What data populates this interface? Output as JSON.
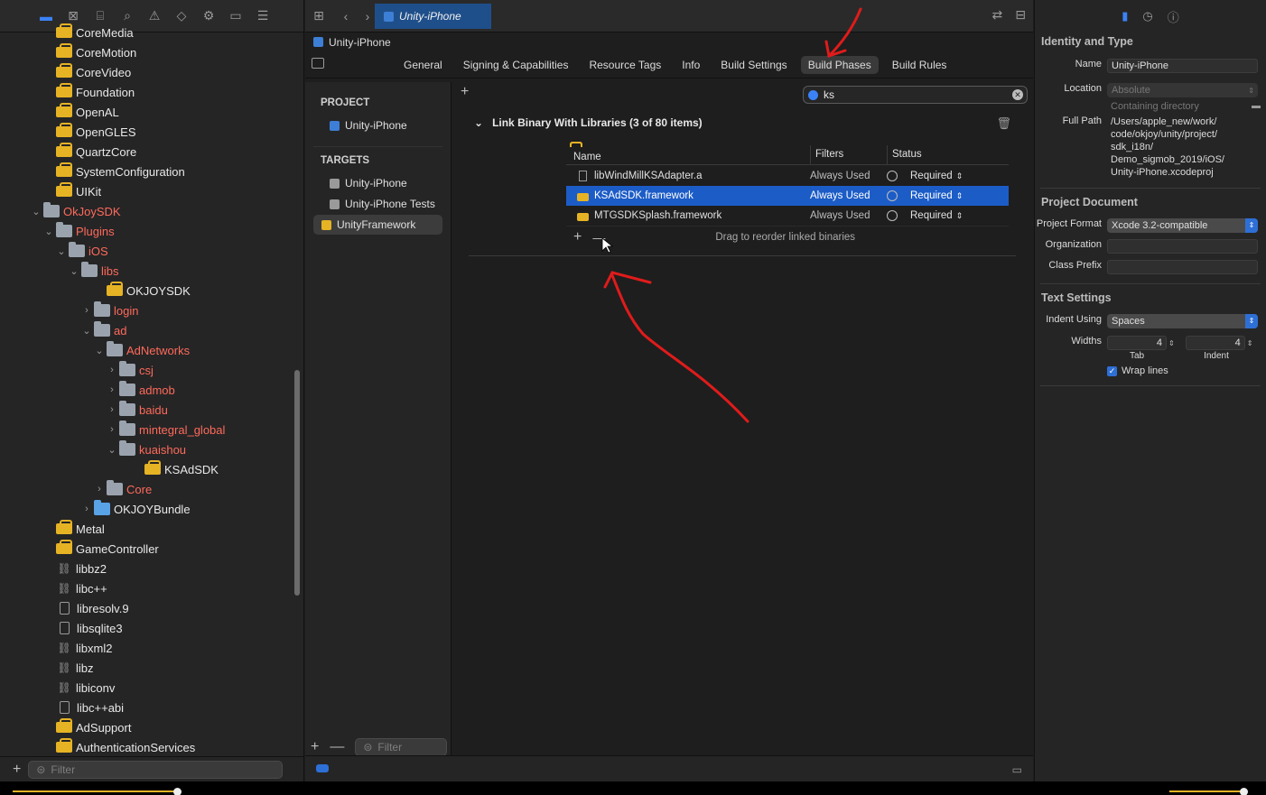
{
  "navigator": {
    "filter_placeholder": "Filter",
    "tree": [
      {
        "label": "CoreMedia",
        "icon": "framework",
        "indent": 60,
        "chevron": "",
        "red": false
      },
      {
        "label": "CoreMotion",
        "icon": "framework",
        "indent": 60,
        "chevron": "",
        "red": false
      },
      {
        "label": "CoreVideo",
        "icon": "framework",
        "indent": 60,
        "chevron": "",
        "red": false
      },
      {
        "label": "Foundation",
        "icon": "framework",
        "indent": 60,
        "chevron": "",
        "red": false
      },
      {
        "label": "OpenAL",
        "icon": "framework",
        "indent": 60,
        "chevron": "",
        "red": false
      },
      {
        "label": "OpenGLES",
        "icon": "framework",
        "indent": 60,
        "chevron": "",
        "red": false
      },
      {
        "label": "QuartzCore",
        "icon": "framework",
        "indent": 60,
        "chevron": "",
        "red": false
      },
      {
        "label": "SystemConfiguration",
        "icon": "framework",
        "indent": 60,
        "chevron": "",
        "red": false
      },
      {
        "label": "UIKit",
        "icon": "framework",
        "indent": 60,
        "chevron": "",
        "red": false
      },
      {
        "label": "OkJoySDK",
        "icon": "folder",
        "indent": 46,
        "chevron": "v",
        "red": true
      },
      {
        "label": "Plugins",
        "icon": "folder",
        "indent": 60,
        "chevron": "v",
        "red": true
      },
      {
        "label": "iOS",
        "icon": "folder",
        "indent": 74,
        "chevron": "v",
        "red": true
      },
      {
        "label": "libs",
        "icon": "folder",
        "indent": 88,
        "chevron": "v",
        "red": true
      },
      {
        "label": "OKJOYSDK",
        "icon": "framework",
        "indent": 116,
        "chevron": "",
        "red": false
      },
      {
        "label": "login",
        "icon": "folder",
        "indent": 102,
        "chevron": ">",
        "red": true
      },
      {
        "label": "ad",
        "icon": "folder",
        "indent": 102,
        "chevron": "v",
        "red": true
      },
      {
        "label": "AdNetworks",
        "icon": "folder",
        "indent": 116,
        "chevron": "v",
        "red": true
      },
      {
        "label": "csj",
        "icon": "folder",
        "indent": 130,
        "chevron": ">",
        "red": true
      },
      {
        "label": "admob",
        "icon": "folder",
        "indent": 130,
        "chevron": ">",
        "red": true
      },
      {
        "label": "baidu",
        "icon": "folder",
        "indent": 130,
        "chevron": ">",
        "red": true
      },
      {
        "label": "mintegral_global",
        "icon": "folder",
        "indent": 130,
        "chevron": ">",
        "red": true
      },
      {
        "label": "kuaishou",
        "icon": "folder",
        "indent": 130,
        "chevron": "v",
        "red": true
      },
      {
        "label": "KSAdSDK",
        "icon": "framework",
        "indent": 158,
        "chevron": "",
        "red": false
      },
      {
        "label": "Core",
        "icon": "folder",
        "indent": 116,
        "chevron": ">",
        "red": true
      },
      {
        "label": "OKJOYBundle",
        "icon": "bluefolder",
        "indent": 102,
        "chevron": ">",
        "red": false
      },
      {
        "label": "Metal",
        "icon": "framework",
        "indent": 60,
        "chevron": "",
        "red": false
      },
      {
        "label": "GameController",
        "icon": "framework",
        "indent": 60,
        "chevron": "",
        "red": false
      },
      {
        "label": "libbz2",
        "icon": "link",
        "indent": 60,
        "chevron": "",
        "red": false
      },
      {
        "label": "libc++",
        "icon": "link",
        "indent": 60,
        "chevron": "",
        "red": false
      },
      {
        "label": "libresolv.9",
        "icon": "doc",
        "indent": 60,
        "chevron": "",
        "red": false
      },
      {
        "label": "libsqlite3",
        "icon": "doc",
        "indent": 60,
        "chevron": "",
        "red": false
      },
      {
        "label": "libxml2",
        "icon": "link",
        "indent": 60,
        "chevron": "",
        "red": false
      },
      {
        "label": "libz",
        "icon": "link",
        "indent": 60,
        "chevron": "",
        "red": false
      },
      {
        "label": "libiconv",
        "icon": "link",
        "indent": 60,
        "chevron": "",
        "red": false
      },
      {
        "label": "libc++abi",
        "icon": "doc",
        "indent": 60,
        "chevron": "",
        "red": false
      },
      {
        "label": "AdSupport",
        "icon": "framework",
        "indent": 60,
        "chevron": "",
        "red": false
      },
      {
        "label": "AuthenticationServices",
        "icon": "framework",
        "indent": 60,
        "chevron": "",
        "red": false
      }
    ]
  },
  "editor": {
    "tab_title": "Unity-iPhone",
    "jumpbar": "Unity-iPhone",
    "tabs": [
      "General",
      "Signing & Capabilities",
      "Resource Tags",
      "Info",
      "Build Settings",
      "Build Phases",
      "Build Rules"
    ],
    "active_tab": "Build Phases",
    "project_header": "PROJECT",
    "project_item": "Unity-iPhone",
    "targets_header": "TARGETS",
    "targets": [
      "Unity-iPhone",
      "Unity-iPhone Tests",
      "UnityFramework"
    ],
    "selected_target": "UnityFramework",
    "targets_filter_placeholder": "Filter",
    "search_value": "ks",
    "phase_title": "Link Binary With Libraries (3 of 80 items)",
    "columns": {
      "name": "Name",
      "filters": "Filters",
      "status": "Status"
    },
    "libraries": [
      {
        "name": "libWindMillKSAdapter.a",
        "icon": "doc",
        "filters": "Always Used",
        "status": "Required",
        "selected": false
      },
      {
        "name": "KSAdSDK.framework",
        "icon": "framework",
        "filters": "Always Used",
        "status": "Required",
        "selected": true
      },
      {
        "name": "MTGSDKSplash.framework",
        "icon": "framework",
        "filters": "Always Used",
        "status": "Required",
        "selected": false
      }
    ],
    "drag_hint": "Drag to reorder linked binaries"
  },
  "inspector": {
    "identity_title": "Identity and Type",
    "name_label": "Name",
    "name_value": "Unity-iPhone",
    "location_label": "Location",
    "location_value": "Absolute",
    "containing_dir": "Containing directory",
    "fullpath_label": "Full Path",
    "fullpath_lines": [
      "/Users/apple_new/work/",
      "code/okjoy/unity/project/",
      "sdk_i18n/",
      "Demo_sigmob_2019/iOS/",
      "Unity-iPhone.xcodeproj"
    ],
    "project_doc_title": "Project Document",
    "format_label": "Project Format",
    "format_value": "Xcode 3.2-compatible",
    "org_label": "Organization",
    "prefix_label": "Class Prefix",
    "text_settings_title": "Text Settings",
    "indent_using_label": "Indent Using",
    "indent_using_value": "Spaces",
    "widths_label": "Widths",
    "tab_width": "4",
    "indent_width": "4",
    "tab_caption": "Tab",
    "indent_caption": "Indent",
    "wrap_label": "Wrap lines"
  },
  "colors": {
    "accent": "#1c5cc7",
    "annotation": "#e01b1b",
    "missing_file": "#ff6a5a",
    "framework": "#e6b325"
  }
}
